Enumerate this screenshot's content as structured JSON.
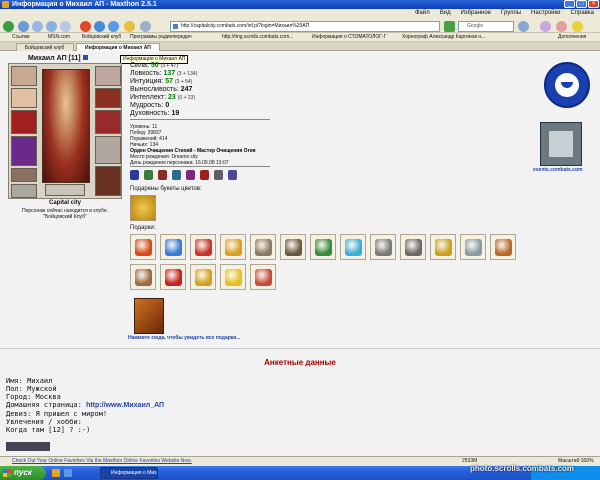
{
  "window": {
    "title": "Информация о Михаил АП - Maxthon 2.5.1",
    "controls": [
      "_",
      "□",
      "×"
    ]
  },
  "menu": [
    "Файл",
    "Вид",
    "Избранное",
    "Группы",
    "Настройки",
    "Справка"
  ],
  "nav": {
    "address": "http://capitalcity.combats.com/inf.pl?login=Михаил%20АП",
    "search_placeholder": "Google"
  },
  "links": [
    "Ссылки",
    "MSN.com",
    "Бойцовский клуб",
    "Программы радиопередач",
    "http://img.scrolls.combats.com...",
    "Информация о СТОМАТОЛОГ-Г",
    "Хореограф Александр Каргинов н...",
    "Дополнения"
  ],
  "tabs": [
    "Бойцовский клуб",
    "Информация о Михаил АП"
  ],
  "tooltip": "Информация о Михаил АП",
  "character": {
    "name": "Михаил АП [11]",
    "city": "Capital city",
    "location_line1": "Персонаж сейчас находится в клубе.",
    "location_line2": "\"Бойцовский Клуб\""
  },
  "stats": [
    {
      "label": "Сила:",
      "value": "50",
      "extra": "(3 + 47)"
    },
    {
      "label": "Ловкость:",
      "value": "137",
      "extra": "(3 + 134)"
    },
    {
      "label": "Интуиция:",
      "value": "57",
      "extra": "(3 + 54)"
    },
    {
      "label": "Выносливость:",
      "value": "247",
      "extra": ""
    },
    {
      "label": "Интеллект:",
      "value": "23",
      "extra": "(0 + 23)"
    },
    {
      "label": "Мудрость:",
      "value": "0",
      "extra": ""
    },
    {
      "label": "Духовность:",
      "value": "19",
      "extra": ""
    }
  ],
  "info": {
    "level": "Уровень: 11",
    "wins": "Побед: 39837",
    "losses": "Поражений: 414",
    "draws": "Ничьих: 134",
    "order": "Орден Очищения Стихий - Мастер Очищения Огня",
    "birthplace": "Место рождения: Dreams city",
    "birthday": "День рождения персонажа: 16.09.08 13:07"
  },
  "medals": [
    "#2a3a9a",
    "#3a7a3a",
    "#8a2a2a",
    "#2a6a8a",
    "#7a2a7a",
    "#a02020",
    "#606060",
    "#4a4a9a"
  ],
  "bouquet_label": "Подарены букеты цветов:",
  "gifts_label": "Подарки:",
  "gifts_row1": [
    "#d84a1a",
    "#3a7ad8",
    "#c8342a",
    "#d8a020",
    "#8a7a60",
    "#6a5a40",
    "#3a8a3a",
    "#3ab0d8",
    "#7a7a7a",
    "#6a6a6a",
    "#c8a020",
    "#8a9aa0",
    "#b86a2a"
  ],
  "gifts_row2": [
    "#a06a40",
    "#c82020",
    "#d8a020",
    "#e8c020",
    "#c84a3a"
  ],
  "see_all": "Нажмите сюда, чтобы увидеть все подарки...",
  "events_label": "events.combats.com",
  "anketa_title": "Анкетные данные",
  "profile": {
    "name": "Имя: Михаил",
    "sex": "Пол: Мужской",
    "city": "Город: Москва",
    "homepage_label": "Домашняя страница:",
    "homepage_url": "http://www.Михаил_АП",
    "motto": "Девиз: Я пришел с миром!",
    "hobby_label": "Увлечения / хобби:",
    "hobby_text": "Когда там [12] ? :-)"
  },
  "status": {
    "message": "Check Out Your Online Favorites Via the Maxthon Online Favorites Website Now.",
    "info": "2533M",
    "zoom": "Масштаб:100%"
  },
  "taskbar": {
    "start": "пуск",
    "item": "Информация о Михаи...",
    "watermark": "photo.scrolls.combats.com"
  }
}
